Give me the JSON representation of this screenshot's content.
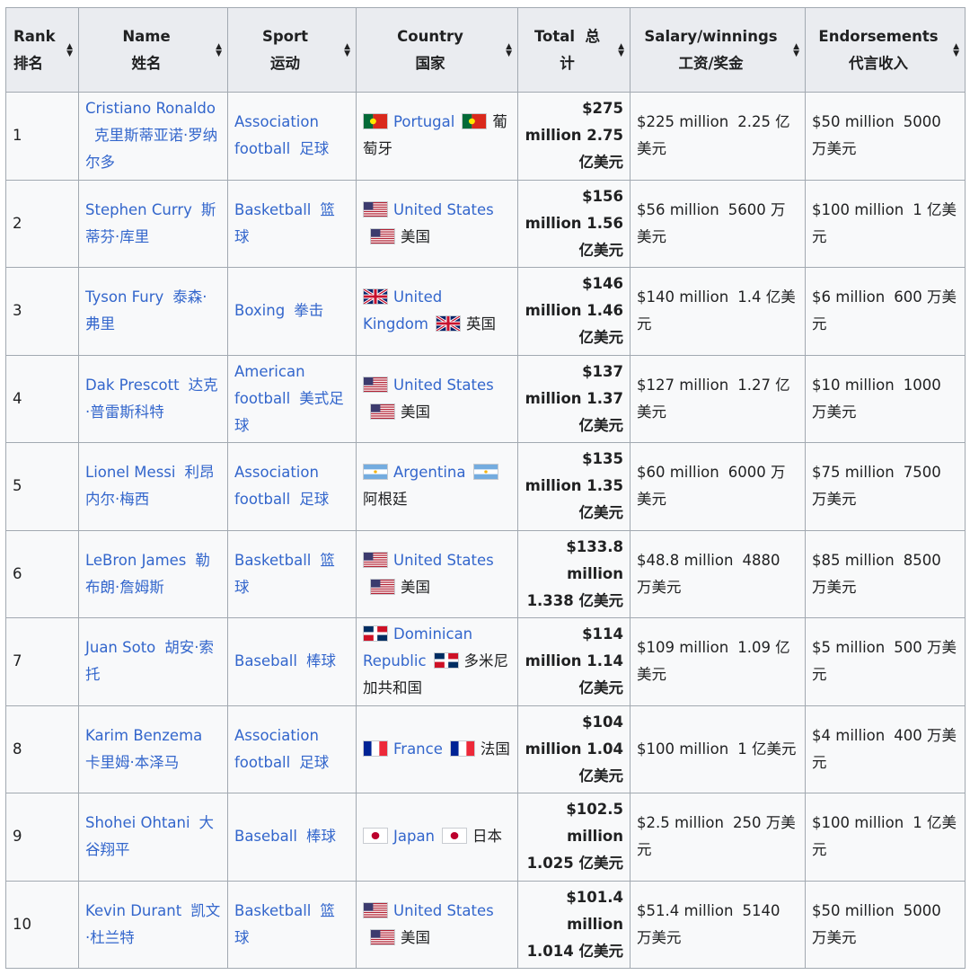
{
  "headers": {
    "rank": {
      "en": "Rank",
      "zh": "排名"
    },
    "name": {
      "en": "Name",
      "zh": "姓名"
    },
    "sport": {
      "en": "Sport",
      "zh": "运动"
    },
    "country": {
      "en": "Country",
      "zh": "国家"
    },
    "total": {
      "en": "Total",
      "zh1": "总",
      "zh2": "计"
    },
    "salary": {
      "en": "Salary/winnings",
      "zh": "工资/奖金"
    },
    "endorse": {
      "en": "Endorsements",
      "zh": "代言收入"
    }
  },
  "icons": {
    "sort": "sort-icon",
    "flags": [
      "flag-portugal-icon",
      "flag-usa-icon",
      "flag-uk-icon",
      "flag-argentina-icon",
      "flag-dominican-icon",
      "flag-france-icon",
      "flag-japan-icon"
    ]
  },
  "rows": [
    {
      "rank": "1",
      "name_en": "Cristiano Ronaldo",
      "name_zh": "克里斯蒂亚诺·罗纳尔多",
      "sport_en": "Association football",
      "sport_zh": "足球",
      "flag": "pt",
      "country_en": "Portugal",
      "country_zh": "葡萄牙",
      "total_usd": "$275 million",
      "total_zh": "2.75 亿美元",
      "salary_usd": "$225 million",
      "salary_zh": "2.25 亿美元",
      "endorse_usd": "$50 million",
      "endorse_zh": "5000 万美元"
    },
    {
      "rank": "2",
      "name_en": "Stephen Curry",
      "name_zh": "斯蒂芬·库里",
      "sport_en": "Basketball",
      "sport_zh": "篮球",
      "flag": "us",
      "country_en": "United States",
      "country_zh": "美国",
      "total_usd": "$156 million",
      "total_zh": "1.56 亿美元",
      "salary_usd": "$56 million",
      "salary_zh": "5600 万美元",
      "endorse_usd": "$100 million",
      "endorse_zh": "1 亿美元"
    },
    {
      "rank": "3",
      "name_en": "Tyson Fury",
      "name_zh": "泰森·弗里",
      "sport_en": "Boxing",
      "sport_zh": "拳击",
      "flag": "uk",
      "country_en": "United Kingdom",
      "country_zh": "英国",
      "total_usd": "$146 million",
      "total_zh": "1.46 亿美元",
      "salary_usd": "$140 million",
      "salary_zh": "1.4 亿美元",
      "endorse_usd": "$6 million",
      "endorse_zh": "600 万美元"
    },
    {
      "rank": "4",
      "name_en": "Dak Prescott",
      "name_zh": "达克·普雷斯科特",
      "sport_en": "American football",
      "sport_zh": "美式足球",
      "flag": "us",
      "country_en": "United States",
      "country_zh": "美国",
      "total_usd": "$137 million",
      "total_zh": "1.37 亿美元",
      "salary_usd": "$127 million",
      "salary_zh": "1.27 亿美元",
      "endorse_usd": "$10 million",
      "endorse_zh": "1000 万美元"
    },
    {
      "rank": "5",
      "name_en": "Lionel Messi",
      "name_zh": "利昂内尔·梅西",
      "sport_en": "Association football",
      "sport_zh": "足球",
      "flag": "ar",
      "country_en": "Argentina",
      "country_zh": "阿根廷",
      "total_usd": "$135 million",
      "total_zh": "1.35 亿美元",
      "salary_usd": "$60 million",
      "salary_zh": "6000 万美元",
      "endorse_usd": "$75 million",
      "endorse_zh": "7500 万美元"
    },
    {
      "rank": "6",
      "name_en": "LeBron James",
      "name_zh": "勒布朗·詹姆斯",
      "sport_en": "Basketball",
      "sport_zh": "篮球",
      "flag": "us",
      "country_en": "United States",
      "country_zh": "美国",
      "total_usd": "$133.8 million",
      "total_zh": "1.338 亿美元",
      "salary_usd": "$48.8 million",
      "salary_zh": "4880 万美元",
      "endorse_usd": "$85 million",
      "endorse_zh": "8500 万美元"
    },
    {
      "rank": "7",
      "name_en": "Juan Soto",
      "name_zh": "胡安·索托",
      "sport_en": "Baseball",
      "sport_zh": "棒球",
      "flag": "do",
      "country_en": "Dominican Republic",
      "country_zh": "多米尼加共和国",
      "total_usd": "$114 million",
      "total_zh": "1.14 亿美元",
      "salary_usd": "$109 million",
      "salary_zh": "1.09 亿美元",
      "endorse_usd": "$5 million",
      "endorse_zh": "500 万美元"
    },
    {
      "rank": "8",
      "name_en": "Karim Benzema",
      "name_zh": "卡里姆·本泽马",
      "sport_en": "Association football",
      "sport_zh": "足球",
      "flag": "fr",
      "country_en": "France",
      "country_zh": "法国",
      "total_usd": "$104 million",
      "total_zh": "1.04 亿美元",
      "salary_usd": "$100 million",
      "salary_zh": "1 亿美元",
      "endorse_usd": "$4 million",
      "endorse_zh": "400 万美元"
    },
    {
      "rank": "9",
      "name_en": "Shohei Ohtani",
      "name_zh": "大谷翔平",
      "sport_en": "Baseball",
      "sport_zh": "棒球",
      "flag": "jp",
      "country_en": "Japan",
      "country_zh": "日本",
      "total_usd": "$102.5 million",
      "total_zh": "1.025 亿美元",
      "salary_usd": "$2.5 million",
      "salary_zh": "250 万美元",
      "endorse_usd": "$100 million",
      "endorse_zh": "1 亿美元"
    },
    {
      "rank": "10",
      "name_en": "Kevin Durant",
      "name_zh": "凯文·杜兰特",
      "sport_en": "Basketball",
      "sport_zh": "篮球",
      "flag": "us",
      "country_en": "United States",
      "country_zh": "美国",
      "total_usd": "$101.4 million",
      "total_zh": "1.014 亿美元",
      "salary_usd": "$51.4 million",
      "salary_zh": "5140 万美元",
      "endorse_usd": "$50 million",
      "endorse_zh": "5000 万美元"
    }
  ]
}
